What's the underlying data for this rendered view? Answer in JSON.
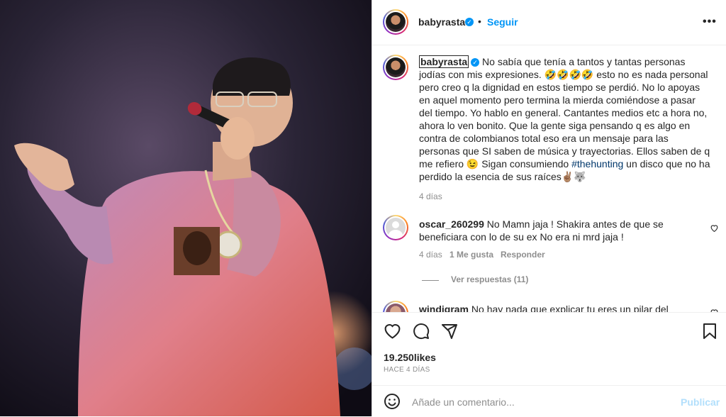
{
  "post": {
    "username": "babyrasta",
    "follow_label": "Seguir",
    "dot": "•",
    "more": "•••"
  },
  "caption": {
    "username": "babyrasta",
    "text_1": "No sabía que tenía a tantos y tantas personas jodías con mis expresiones. 🤣🤣🤣🤣 esto no es nada personal pero creo q la dignidad en estos tiempo se perdió. No lo apoyas en aquel momento pero termina la mierda comiéndose a pasar del tiempo. Yo hablo en general. Cantantes medios etc a hora no, ahora lo ven bonito. Que la gente siga pensando q es algo en contra de colombianos total eso era un mensaje para las personas que SI saben de música y trayectorias. Ellos saben de q me refiero 😉 Sigan consumiendo ",
    "hashtag": "#thehunting",
    "text_2": " un disco que no ha perdido la esencia de sus raíces✌🏽🐺",
    "time": "4 días"
  },
  "comments": [
    {
      "username": "oscar_260299",
      "text": "No Mamn jaja ! Shakira antes de que se beneficiara con lo de su ex No era ni mrd jaja !",
      "time": "4 días",
      "likes": "1 Me gusta",
      "reply": "Responder",
      "view_replies": "Ver respuestas (11)"
    },
    {
      "username": "windigram",
      "text": "No hay nada que explicar tu eres un pilar del"
    }
  ],
  "footer": {
    "likes": "19.250likes",
    "posted_ago": "HACE 4 DÍAS",
    "comment_placeholder": "Añade un comentario...",
    "publish_label": "Publicar"
  },
  "colors": {
    "accent": "#0095f6",
    "link": "#00376b",
    "muted": "#8e8e8e"
  }
}
